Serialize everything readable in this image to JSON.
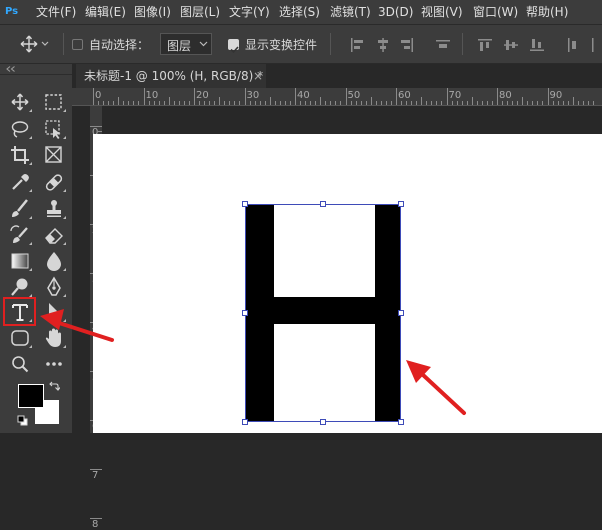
{
  "app": {
    "logo": "Ps"
  },
  "menu": [
    "文件(F)",
    "编辑(E)",
    "图像(I)",
    "图层(L)",
    "文字(Y)",
    "选择(S)",
    "滤镜(T)",
    "3D(D)",
    "视图(V)",
    "窗口(W)",
    "帮助(H)"
  ],
  "options": {
    "auto_select_label": "自动选择：",
    "auto_select_checked": false,
    "layer_select_value": "图层",
    "show_transform_label": "显示变换控件",
    "show_transform_checked": true
  },
  "document": {
    "tab_title": "未标题-1 @ 100% (H, RGB/8) *",
    "close_glyph": "×",
    "canvas_text": "H"
  },
  "ruler": {
    "top_labels": [
      "0",
      "10",
      "20",
      "30",
      "40",
      "50",
      "60",
      "70",
      "80",
      "90"
    ],
    "left_labels": [
      "0",
      "1",
      "2",
      "3",
      "4",
      "5",
      "6",
      "7",
      "8"
    ]
  },
  "colors": {
    "ui_dark": "#3c3c3c",
    "highlight": "#e02020",
    "annotation_arrow": "#e02020",
    "selection_box": "#3e4bb8"
  },
  "annotations": {
    "highlighted_tool": "type-tool",
    "arrow_count": 2
  }
}
